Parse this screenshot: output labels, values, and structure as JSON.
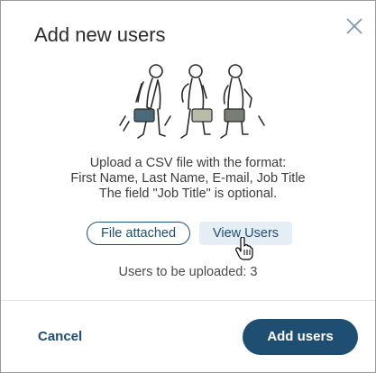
{
  "dialog": {
    "title": "Add new users",
    "close_icon": "close-icon",
    "illustration": "walking-people-with-bags"
  },
  "instructions": {
    "line1": "Upload a CSV file with the format:",
    "line2": "First Name, Last Name, E-mail, Job Title",
    "line3": "The field \"Job Title\" is optional."
  },
  "actions": {
    "file_attached_label": "File attached",
    "view_users_label": "View Users"
  },
  "status": {
    "users_to_upload": "Users to be uploaded: 3"
  },
  "footer": {
    "cancel_label": "Cancel",
    "add_users_label": "Add users"
  },
  "colors": {
    "accent": "#1e4f73",
    "view_users_bg": "#e6eef5",
    "text": "#3c3c3c"
  }
}
